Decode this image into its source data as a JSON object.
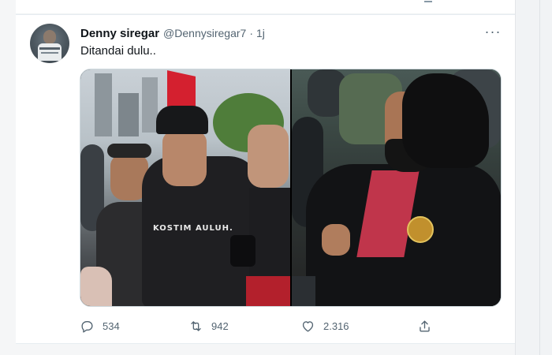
{
  "tweet": {
    "display_name": "Denny siregar",
    "handle": "@Dennysiregar7",
    "separator": "·",
    "time": "1j",
    "more_label": "···",
    "text": "Ditandai dulu..",
    "hoodie_print": "KOSTIM AULUH.",
    "avatar_icon": "user-avatar",
    "media": {
      "count": 2
    },
    "stats": {
      "replies": "534",
      "retweets": "942",
      "likes": "2.316"
    },
    "icons": {
      "reply": "reply-icon",
      "retweet": "retweet-icon",
      "like": "heart-icon",
      "share": "share-icon"
    }
  },
  "colors": {
    "text_primary": "#0f1419",
    "text_secondary": "#536471",
    "border": "#cfd9de"
  }
}
